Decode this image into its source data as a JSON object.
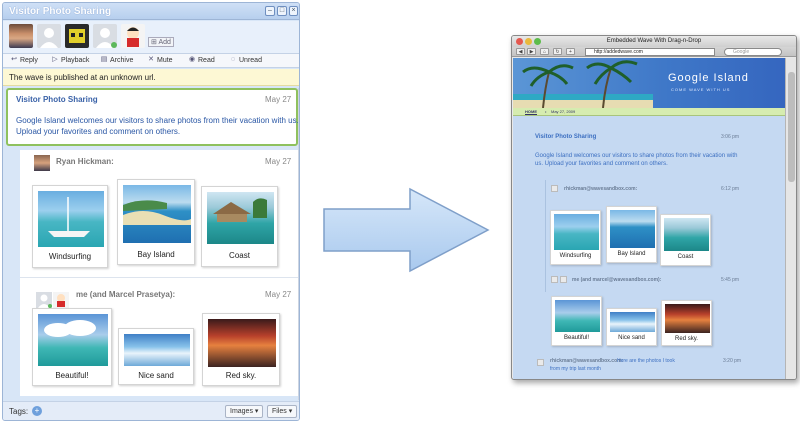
{
  "wave": {
    "title": "Visitor Photo Sharing",
    "add_label": "Add",
    "toolbar": [
      {
        "label": "Reply",
        "icon": "reply-icon"
      },
      {
        "label": "Playback",
        "icon": "playback-icon"
      },
      {
        "label": "Archive",
        "icon": "archive-icon"
      },
      {
        "label": "Mute",
        "icon": "mute-icon"
      },
      {
        "label": "Read",
        "icon": "read-icon"
      },
      {
        "label": "Unread",
        "icon": "unread-icon"
      }
    ],
    "notice": "The wave is published at an unknown url.",
    "root_blip": {
      "title": "Visitor Photo Sharing",
      "date": "May 27",
      "text_1": "Google Island welcomes our visitors to share photos from their vacation with us.",
      "text_2": "Upload your favorites and comment on others."
    },
    "reply1": {
      "author": "Ryan Hickman:",
      "date": "May 27",
      "photos": [
        "Windsurfing",
        "Bay Island",
        "Coast"
      ]
    },
    "reply2": {
      "author": "me (and Marcel Prasetya):",
      "date": "May 27",
      "photos": [
        "Beautiful!",
        "Nice sand",
        "Red sky."
      ]
    },
    "tags_label": "Tags:",
    "images_button": "Images",
    "files_button": "Files"
  },
  "browser": {
    "window_title": "Embedded Wave With Drag-n-Drop",
    "url": "http://addedwave.com",
    "search_placeholder": "Google",
    "site_title": "Google Island",
    "site_subtitle": "COME WAVE WITH US",
    "nav_home": "HOME",
    "nav_date": "May 27, 2009",
    "blip_title": "Visitor Photo Sharing",
    "blip_time": "3:06 pm",
    "blip_text_1": "Google Island welcomes our visitors to share photos from their vacation with",
    "blip_text_2": "us. Upload your favorites and comment on others.",
    "reply1_author": "rhickman@wavesandbox.com:",
    "reply1_time": "6:12 pm",
    "reply1_photos": [
      "Windsurfing",
      "Bay Island",
      "Coast"
    ],
    "reply2_author": "me (and marcel@wavesandbox.com):",
    "reply2_time": "5:45 pm",
    "reply2_photos": [
      "Beautiful!",
      "Nice sand",
      "Red sky."
    ],
    "reply3_author": "rhickman@wavesandbox.com:",
    "reply3_text_1": "Here are the photos I took",
    "reply3_text_2": "from my trip last month",
    "reply3_time": "3:20 pm"
  }
}
